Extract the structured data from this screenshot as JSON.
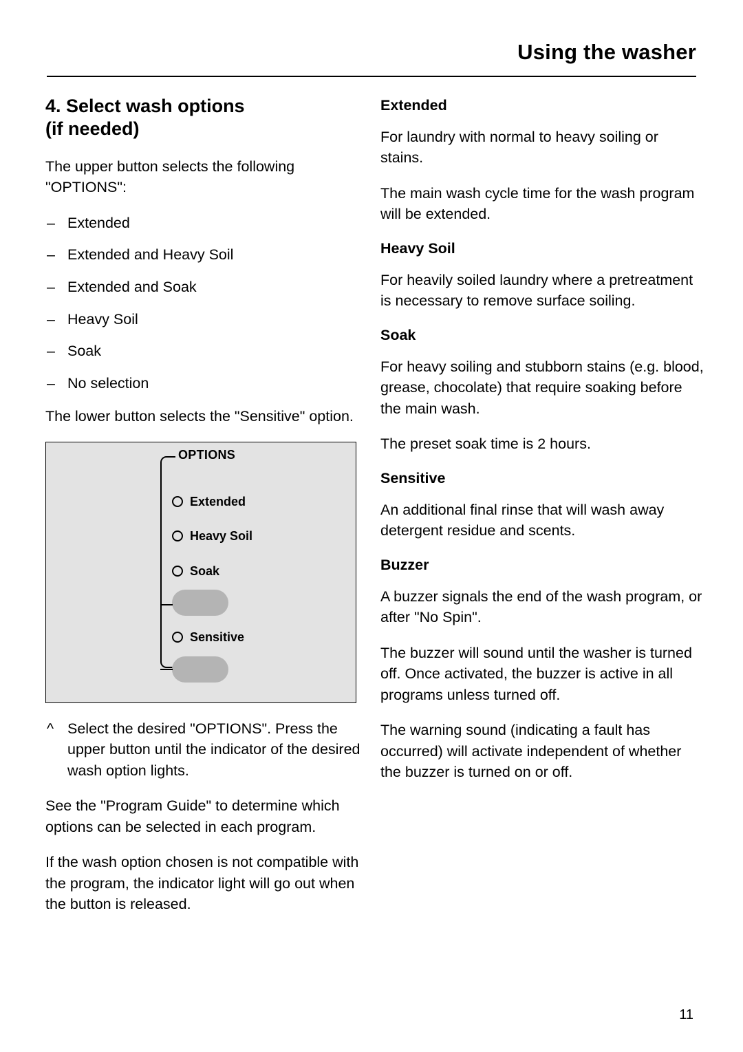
{
  "header": {
    "title": "Using the washer"
  },
  "left": {
    "section_title_line1": "4. Select wash options",
    "section_title_line2": "(if needed)",
    "intro": "The upper button selects the following \"OPTIONS\":",
    "options": [
      "Extended",
      "Extended and Heavy Soil",
      "Extended and Soak",
      "Heavy Soil",
      "Soak",
      "No selection"
    ],
    "dash": "–",
    "lower_button_text": "The lower button selects the \"Sensitive\" option.",
    "panel": {
      "group_label": "OPTIONS",
      "items": [
        "Extended",
        "Heavy Soil",
        "Soak"
      ],
      "sensitive_label": "Sensitive"
    },
    "caret": "^",
    "note": "Select the desired \"OPTIONS\". Press the upper button until the indicator of the desired wash option lights.",
    "paragraph_guide": "See the \"Program Guide\" to determine which options can be selected in each program.",
    "paragraph_incompatible": "If the wash option chosen is not compatible with the program, the indicator light will go out when the button is released."
  },
  "right": {
    "extended_heading": "Extended",
    "extended_p1": "For laundry with normal to heavy soiling or stains.",
    "extended_p2": "The main wash cycle time for the wash program will be extended.",
    "heavy_soil_heading": "Heavy Soil",
    "heavy_soil_p1": "For heavily soiled laundry where a pretreatment is necessary to remove surface soiling.",
    "soak_heading": "Soak",
    "soak_p1": "For heavy soiling and stubborn stains (e.g. blood, grease, chocolate) that require soaking before the main wash.",
    "soak_p2": "The preset soak time is 2 hours.",
    "sensitive_heading": "Sensitive",
    "sensitive_p1": "An additional final rinse that will wash away detergent residue and scents.",
    "buzzer_heading": "Buzzer",
    "buzzer_p1": "A buzzer signals the end of the wash program, or after \"No Spin\".",
    "buzzer_p2": "The buzzer will sound until the washer is turned off. Once activated, the buzzer is active in all programs unless turned off.",
    "buzzer_p3": "The warning sound (indicating a fault has occurred) will activate independent of whether the buzzer is turned on or off."
  },
  "footer": {
    "page_number": "11"
  }
}
